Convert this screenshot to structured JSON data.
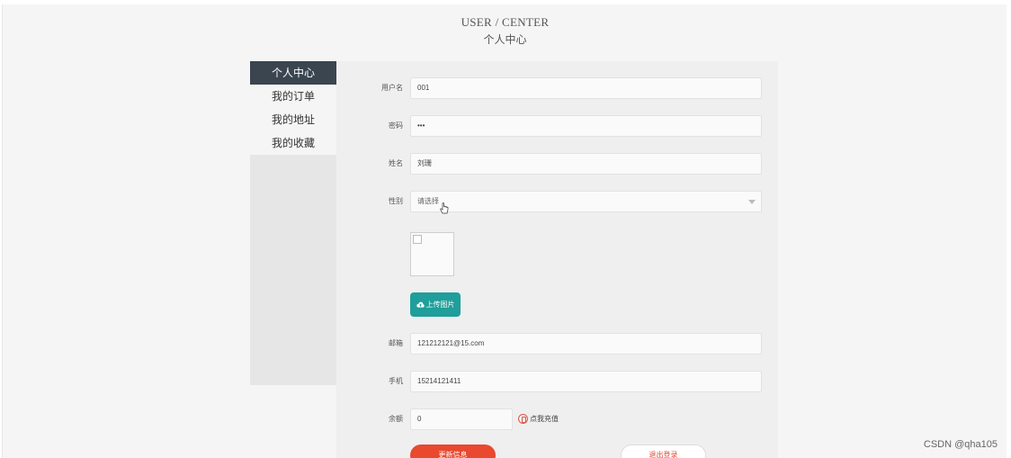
{
  "header": {
    "title_en": "USER / CENTER",
    "title_cn": "个人中心"
  },
  "sidebar": {
    "items": [
      {
        "label": "个人中心",
        "active": true
      },
      {
        "label": "我的订单",
        "active": false
      },
      {
        "label": "我的地址",
        "active": false
      },
      {
        "label": "我的收藏",
        "active": false
      }
    ]
  },
  "form": {
    "username": {
      "label": "用户名",
      "value": "001"
    },
    "password": {
      "label": "密码",
      "value": "•••"
    },
    "name": {
      "label": "姓名",
      "value": "刘珊"
    },
    "gender": {
      "label": "性别",
      "placeholder": "请选择"
    },
    "upload_label": "上传图片",
    "email": {
      "label": "邮箱",
      "value": "121212121@15.com"
    },
    "phone": {
      "label": "手机",
      "value": "15214121411"
    },
    "balance": {
      "label": "余额",
      "value": "0",
      "recharge_label": "点我充值"
    }
  },
  "buttons": {
    "update": "更新信息",
    "logout": "退出登录"
  },
  "watermark": "CSDN @qha105",
  "colors": {
    "accent_teal": "#1f9e9b",
    "accent_red": "#e8492f",
    "sidebar_active": "#3a4550"
  },
  "icons": [
    "cloud-upload-icon",
    "chevron-down-icon",
    "hand-cursor-icon",
    "recharge-icon",
    "broken-image-icon"
  ]
}
